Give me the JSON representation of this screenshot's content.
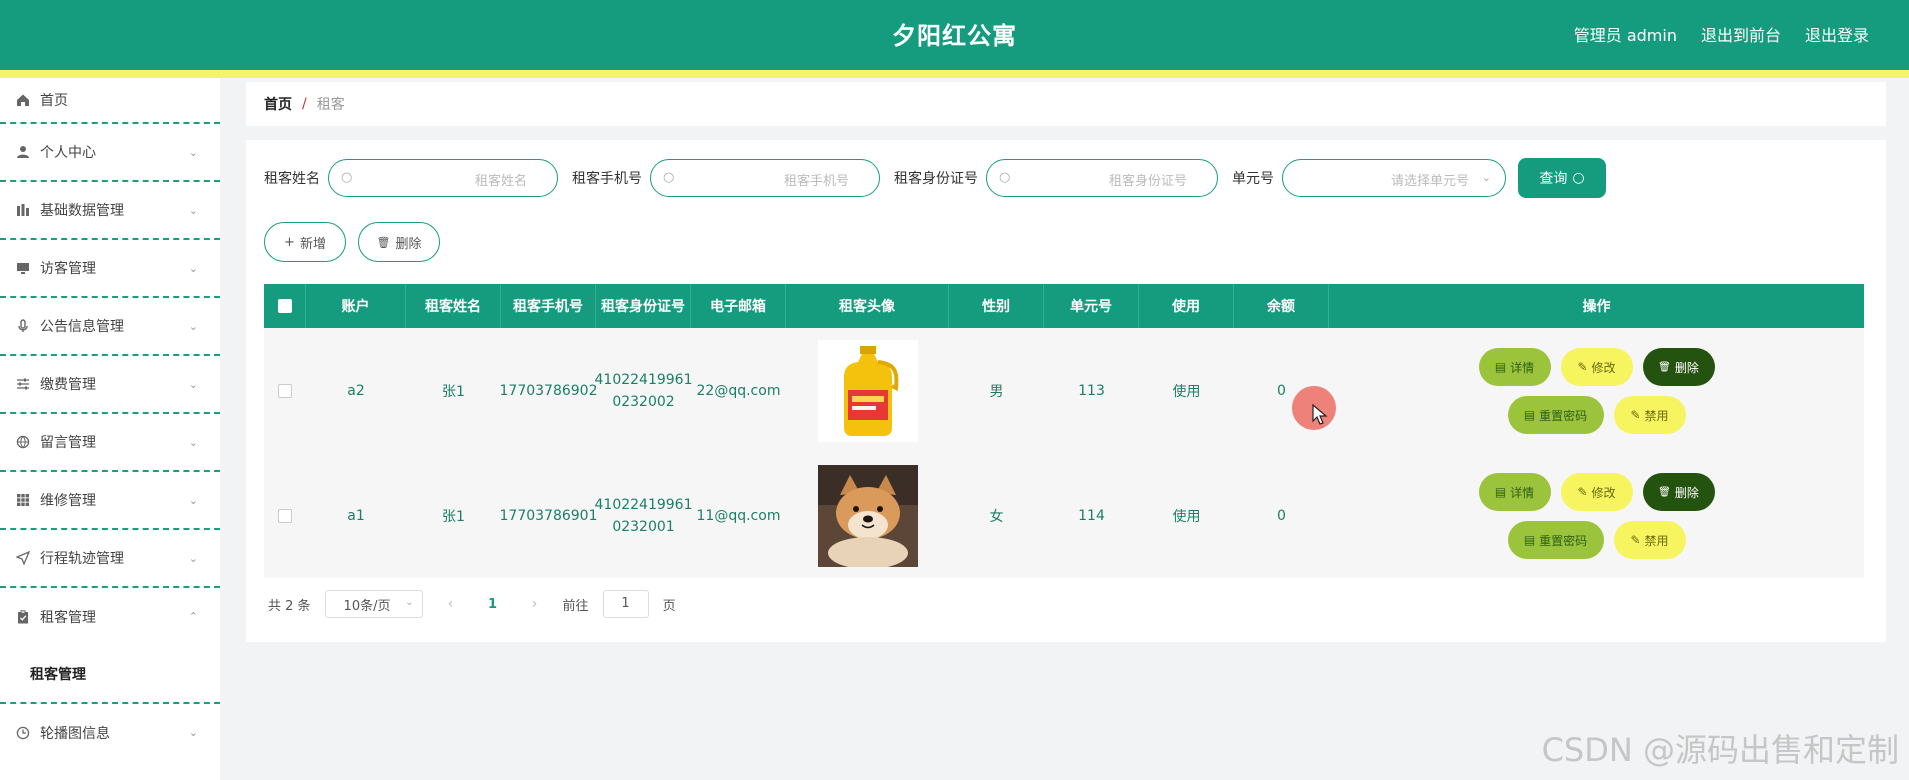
{
  "header": {
    "title": "夕阳红公寓",
    "admin_label": "管理员 admin",
    "back_front": "退出到前台",
    "logout": "退出登录"
  },
  "sidebar": {
    "items": [
      {
        "label": "首页",
        "icon": "home-icon"
      },
      {
        "label": "个人中心",
        "icon": "user-icon"
      },
      {
        "label": "基础数据管理",
        "icon": "chart-icon"
      },
      {
        "label": "访客管理",
        "icon": "monitor-icon"
      },
      {
        "label": "公告信息管理",
        "icon": "mic-icon"
      },
      {
        "label": "缴费管理",
        "icon": "sliders-icon"
      },
      {
        "label": "留言管理",
        "icon": "globe-icon"
      },
      {
        "label": "维修管理",
        "icon": "grid-icon"
      },
      {
        "label": "行程轨迹管理",
        "icon": "send-icon"
      },
      {
        "label": "租客管理",
        "icon": "clipboard-icon"
      },
      {
        "label": "轮播图信息",
        "icon": "clock-icon"
      }
    ],
    "submenu": {
      "label": "租客管理"
    }
  },
  "breadcrumb": {
    "home": "首页",
    "separator": "/",
    "current": "租客"
  },
  "search": {
    "name_label": "租客姓名",
    "name_placeholder": "租客姓名",
    "phone_label": "租客手机号",
    "phone_placeholder": "租客手机号",
    "id_label": "租客身份证号",
    "id_placeholder": "租客身份证号",
    "unit_label": "单元号",
    "unit_placeholder": "请选择单元号",
    "query_button": "查询"
  },
  "actions": {
    "add": "新增",
    "delete": "删除"
  },
  "table": {
    "headers": [
      "账户",
      "租客姓名",
      "租客手机号",
      "租客身份证号",
      "电子邮箱",
      "租客头像",
      "性别",
      "单元号",
      "使用",
      "余额",
      "操作"
    ],
    "rows": [
      {
        "account": "a2",
        "name": "张1",
        "phone": "17703786902",
        "id_line1": "41022419961",
        "id_line2": "0232002",
        "email": "22@qq.com",
        "avatar": "oil-bottle",
        "gender": "男",
        "unit": "113",
        "use": "使用",
        "balance": "0"
      },
      {
        "account": "a1",
        "name": "张1",
        "phone": "17703786901",
        "id_line1": "41022419961",
        "id_line2": "0232001",
        "email": "11@qq.com",
        "avatar": "shiba-dog",
        "gender": "女",
        "unit": "114",
        "use": "使用",
        "balance": "0"
      }
    ],
    "ops": {
      "detail": "详情",
      "edit": "修改",
      "delete": "删除",
      "reset": "重置密码",
      "ban": "禁用"
    }
  },
  "pager": {
    "total": "共 2 条",
    "page_size": "10条/页",
    "current": "1",
    "goto_label": "前往",
    "goto_value": "1",
    "page_unit": "页"
  },
  "watermark": "CSDN @源码出售和定制",
  "colors": {
    "primary": "#159c7e",
    "stripe": "#f2f56a",
    "detail": "#9bc33c",
    "edit": "#f6f45f",
    "delete": "#24520f"
  }
}
